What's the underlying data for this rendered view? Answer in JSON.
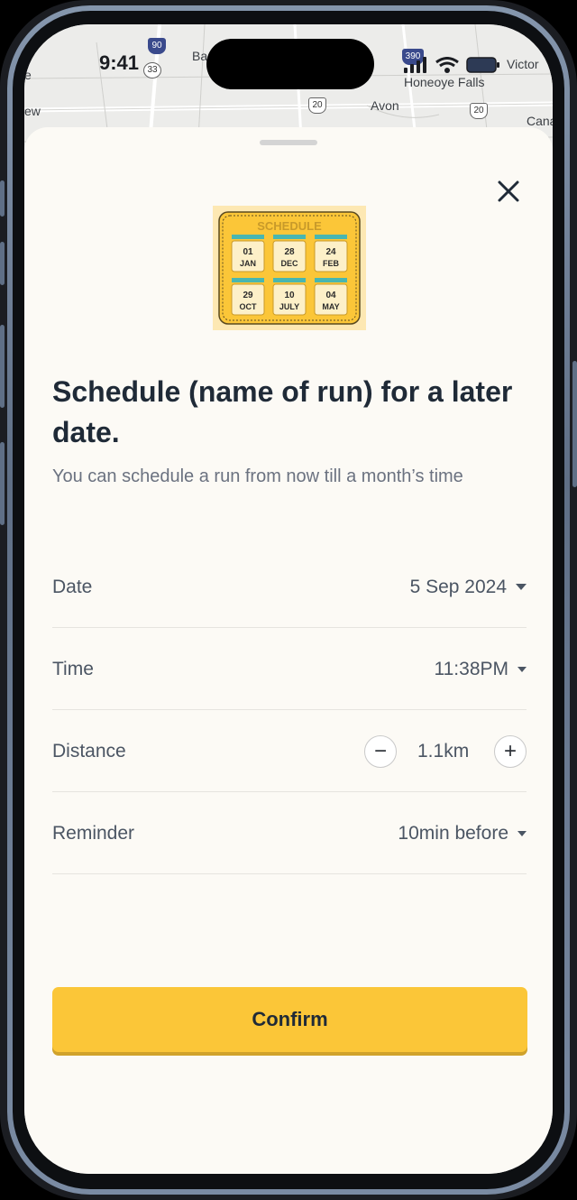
{
  "status_bar": {
    "time": "9:41"
  },
  "map": {
    "labels": [
      "Honeoye Falls",
      "Avon",
      "Canandaigua",
      "Victor",
      "Ba",
      "ew",
      "a",
      "e"
    ],
    "shields": [
      "90",
      "33",
      "20",
      "20",
      "390"
    ]
  },
  "sheet": {
    "illustration": {
      "header": "SCHEDULE",
      "tiles": [
        {
          "day": "01",
          "month": "JAN"
        },
        {
          "day": "28",
          "month": "DEC"
        },
        {
          "day": "24",
          "month": "FEB"
        },
        {
          "day": "29",
          "month": "OCT"
        },
        {
          "day": "10",
          "month": "JULY"
        },
        {
          "day": "04",
          "month": "MAY"
        }
      ]
    },
    "title": "Schedule (name of run) for a later date.",
    "subtitle": "You can schedule a run from now till a month’s time",
    "rows": {
      "date": {
        "label": "Date",
        "value": "5 Sep 2024"
      },
      "time": {
        "label": "Time",
        "value": "11:38PM"
      },
      "distance": {
        "label": "Distance",
        "value": "1.1km",
        "minus": "−",
        "plus": "+"
      },
      "reminder": {
        "label": "Reminder",
        "value": "10min before"
      }
    },
    "confirm_label": "Confirm"
  },
  "colors": {
    "accent": "#fbc638",
    "text_dark": "#1f2a37",
    "text_muted": "#6b7280",
    "sheet_bg": "#fcfaf5"
  },
  "icons": [
    "close-icon",
    "caret-down-icon",
    "minus-icon",
    "plus-icon",
    "signal-icon",
    "wifi-icon",
    "battery-icon"
  ]
}
